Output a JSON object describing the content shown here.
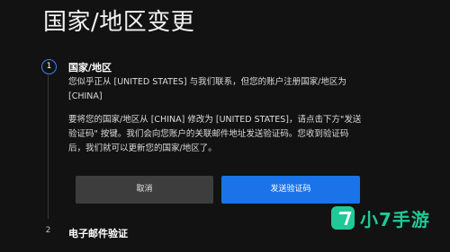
{
  "page": {
    "title": "国家/地区变更"
  },
  "steps": [
    {
      "number": "1",
      "title": "国家/地区",
      "paragraph1": "您似乎正从 [UNITED STATES] 与我们联系，但您的账户注册国家/地区为 [CHINA]",
      "paragraph2": "要将您的国家/地区从 [CHINA] 修改为 [UNITED STATES]，请点击下方\"发送验证码\" 按键。我们会向您账户的关联邮件地址发送验证码。您收到验证码后，我们就可以更新您的国家/地区了。",
      "cancel_label": "取消",
      "send_label": "发送验证码"
    },
    {
      "number": "2",
      "title": "电子邮件验证"
    }
  ],
  "watermark": {
    "text": "小7手游"
  },
  "colors": {
    "background": "#121212",
    "accent": "#1a73e8",
    "cancel_button": "#3d3d3d",
    "watermark": "#20c997"
  }
}
